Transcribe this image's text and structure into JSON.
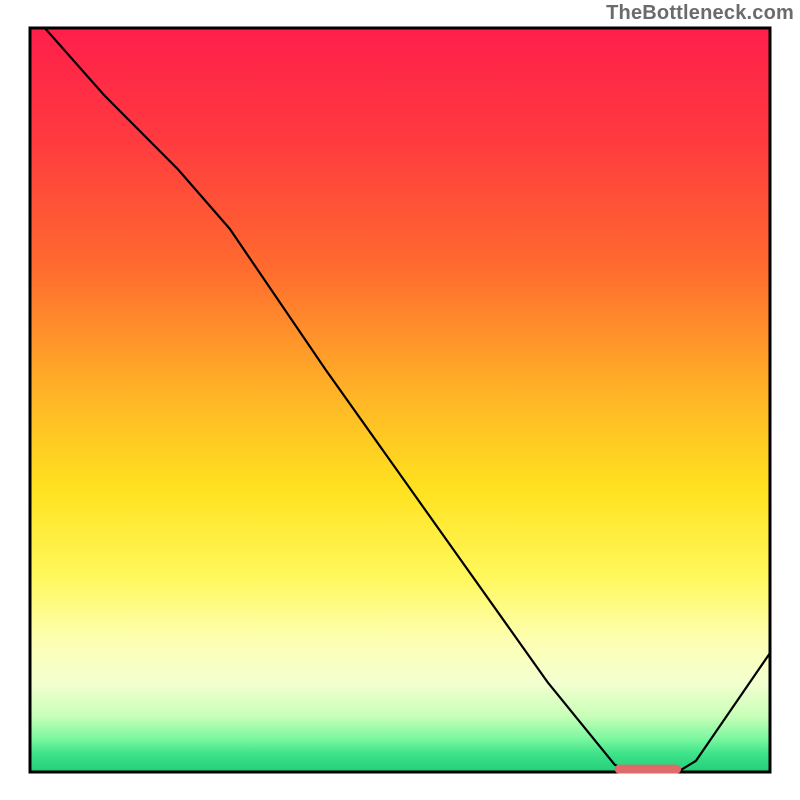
{
  "watermark": "TheBottleneck.com",
  "chart_data": {
    "type": "line",
    "title": "",
    "xlabel": "",
    "ylabel": "",
    "xlim": [
      0,
      100
    ],
    "ylim": [
      0,
      100
    ],
    "grid": false,
    "legend": false,
    "background_gradient_stops": [
      {
        "offset": 0.0,
        "color": "#ff1f4b"
      },
      {
        "offset": 0.15,
        "color": "#ff3a3f"
      },
      {
        "offset": 0.32,
        "color": "#ff6a2f"
      },
      {
        "offset": 0.5,
        "color": "#ffb726"
      },
      {
        "offset": 0.62,
        "color": "#ffe21f"
      },
      {
        "offset": 0.74,
        "color": "#fff85e"
      },
      {
        "offset": 0.82,
        "color": "#fdffb0"
      },
      {
        "offset": 0.88,
        "color": "#f4ffd0"
      },
      {
        "offset": 0.925,
        "color": "#c8ffb8"
      },
      {
        "offset": 0.955,
        "color": "#7cf7a0"
      },
      {
        "offset": 0.975,
        "color": "#3fe38a"
      },
      {
        "offset": 1.0,
        "color": "#21cf78"
      }
    ],
    "series": [
      {
        "name": "bottleneck-curve",
        "stroke": "#000000",
        "stroke_width": 2.2,
        "x": [
          2,
          10,
          20,
          27,
          40,
          55,
          70,
          79,
          81,
          84,
          88,
          90,
          100
        ],
        "values": [
          100,
          91,
          81,
          73,
          54,
          33,
          12,
          1,
          0,
          0,
          0.3,
          1.5,
          16
        ]
      }
    ],
    "optimal_marker": {
      "name": "optimal-range-marker",
      "color": "#e06a6a",
      "x_start": 79,
      "x_end": 88,
      "y": 0.4,
      "thickness": 1.2
    },
    "axes_frame_color": "#000000",
    "frame_thickness": 3
  }
}
